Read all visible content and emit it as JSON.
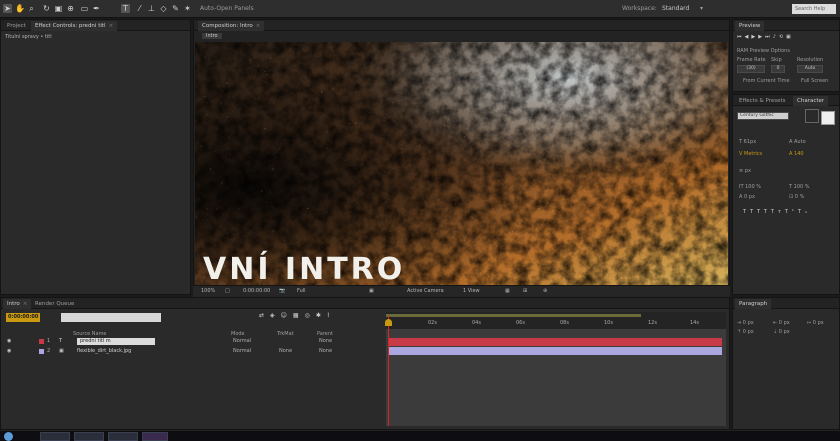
{
  "colors": {
    "accent_orange": "#c99a10",
    "layer_red": "#c8394a",
    "layer_lavender": "#aaa6e0",
    "playhead": "#d22"
  },
  "toolbar": {
    "tools": [
      "selection-tool",
      "hand-tool",
      "zoom-tool",
      "rotate-tool",
      "camera-tool",
      "pan-behind-tool",
      "mask-tool",
      "pen-tool",
      "type-tool",
      "brush-tool",
      "clone-stamp-tool",
      "eraser-tool",
      "roto-brush-tool",
      "puppet-tool"
    ],
    "snapping_label": "Auto-Open Panels",
    "workspace_label": "Workspace:",
    "workspace_value": "Standard",
    "search_placeholder": "Search Help"
  },
  "left_panel": {
    "tab1": "Project",
    "tab2": "Effect Controls: predni titl",
    "subtitle": "Titulni spravy • titl"
  },
  "viewer": {
    "tab": "Composition: Intro",
    "crumb": "Intro",
    "overlay_text": "VNÍ INTRO",
    "controls": [
      "100%",
      "□",
      "0:00:00:00",
      "📷",
      "Full",
      "▣",
      "Active Camera",
      "1 View",
      "▦",
      "⊞",
      "⊕"
    ]
  },
  "preview_panel": {
    "tab": "Preview",
    "ram_label": "RAM Preview Options",
    "frame_rate_label": "Frame Rate",
    "skip_label": "Skip",
    "resolution_label": "Resolution",
    "frame_rate_value": "(30)",
    "skip_value": "0",
    "resolution_value": "Auto",
    "from_current": "From Current Time",
    "full_screen": "Full Screen"
  },
  "character_panel": {
    "tab1": "Effects & Presets",
    "tab2": "Character",
    "font_value": "Century Gothic",
    "size1": "61px",
    "size2": "Auto",
    "tracking": "Metrics",
    "tracking2": "140",
    "scale1": "100 %",
    "scale2": "100 %",
    "baseline": "0 px",
    "tsume": "0 %",
    "px_label": "px"
  },
  "timeline": {
    "tab1": "Intro",
    "tab2": "Render Queue",
    "timecode": "0:00:00:00",
    "search_placeholder": "",
    "headers": {
      "name": "Source Name",
      "mode": "Mode",
      "trkmat": "TrkMat",
      "parent": "Parent"
    },
    "ruler": [
      "0s",
      "02s",
      "04s",
      "06s",
      "08s",
      "10s",
      "12s",
      "14s"
    ],
    "layers": [
      {
        "index": "1",
        "name": "predni titl m",
        "mode": "Normal",
        "trkmat": "",
        "parent": "None",
        "color": "#c8394a"
      },
      {
        "index": "2",
        "name": "flexible_dirt_black.jpg",
        "mode": "Normal",
        "trkmat": "None",
        "parent": "None",
        "color": "#aaa6e0"
      }
    ]
  },
  "paragraph_panel": {
    "tab": "Paragraph",
    "values": [
      "0 px",
      "0 px",
      "0 px",
      "0 px",
      "0 px"
    ]
  }
}
